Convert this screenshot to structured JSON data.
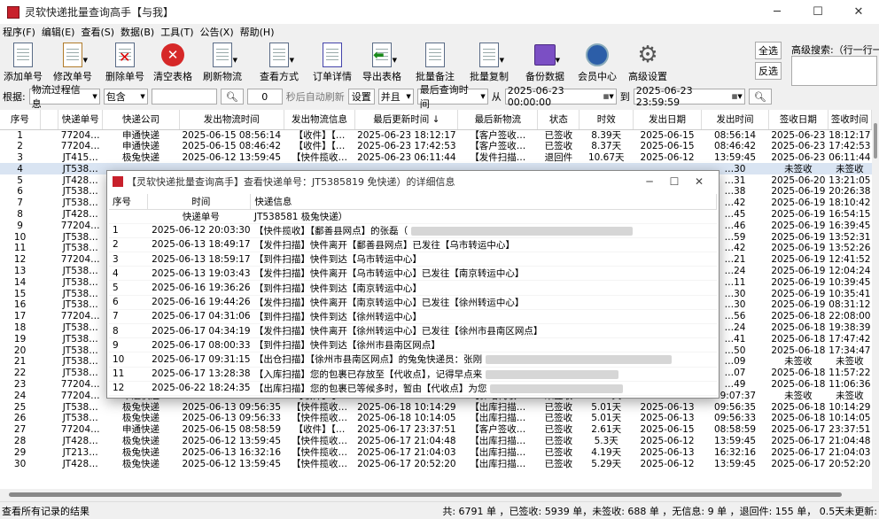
{
  "window": {
    "title": "灵软快递批量查询高手【与我】",
    "buttons": [
      "─",
      "☐",
      "✕"
    ]
  },
  "menu": [
    "程序(F)",
    "编辑(E)",
    "查看(S)",
    "数据(B)",
    "工具(T)",
    "公告(X)",
    "帮助(H)"
  ],
  "toolbar": [
    {
      "label": "添加单号",
      "icon": "add-doc-icon",
      "dd": false
    },
    {
      "label": "修改单号",
      "icon": "edit-doc-icon",
      "dd": true
    },
    {
      "label": "删除单号",
      "icon": "delete-doc-icon",
      "dd": false
    },
    {
      "label": "清空表格",
      "icon": "clear-table-icon",
      "dd": false
    },
    {
      "label": "刷新物流",
      "icon": "refresh-doc-icon",
      "dd": true
    },
    {
      "label": "查看方式",
      "icon": "view-mode-icon",
      "dd": true
    },
    {
      "label": "订单详情",
      "icon": "order-detail-icon",
      "dd": false
    },
    {
      "label": "导出表格",
      "icon": "export-table-icon",
      "dd": true
    },
    {
      "label": "批量备注",
      "icon": "batch-note-icon",
      "dd": false
    },
    {
      "label": "批量复制",
      "icon": "batch-copy-icon",
      "dd": true
    },
    {
      "label": "备份数据",
      "icon": "backup-icon",
      "dd": true
    },
    {
      "label": "会员中心",
      "icon": "member-center-icon",
      "dd": false
    },
    {
      "label": "高级设置",
      "icon": "gear-icon",
      "dd": false
    }
  ],
  "side_buttons": {
    "select_all": "全选",
    "invert": "反选"
  },
  "advanced_search": {
    "label": "高级搜索:（行一行一",
    "value": ""
  },
  "filter": {
    "by_label": "根据:",
    "by_value": "物流过程信息",
    "match_value": "包含",
    "keyword": "",
    "seconds": "0",
    "auto_refresh": "秒后自动刷新",
    "settings": "设置",
    "logic": "并且",
    "time_field": "最后查询时间",
    "from_label": "从",
    "from_value": "2025-06-23 00:00:00",
    "to_label": "到",
    "to_value": "2025-06-23 23:59:59"
  },
  "grid": {
    "columns": [
      "序号",
      "",
      "快递单号",
      "快递公司",
      "发出物流时间",
      "发出物流信息",
      "最后更新时间 ↓",
      "最后新物流",
      "状态",
      "时效",
      "发出日期",
      "发出时间",
      "签收日期",
      "签收时间"
    ],
    "rows": [
      [
        "1",
        "",
        "77204…",
        "申通快递",
        "2025-06-15  08:56:14",
        "【收件】【…",
        "2025-06-23  18:12:17",
        "【客户签收…",
        "已签收",
        "8.39天",
        "2025-06-15",
        "08:56:14",
        "2025-06-23",
        "18:12:17"
      ],
      [
        "2",
        "",
        "77204…",
        "申通快递",
        "2025-06-15  08:46:42",
        "【收件】【…",
        "2025-06-23  17:42:53",
        "【客户签收…",
        "已签收",
        "8.37天",
        "2025-06-15",
        "08:46:42",
        "2025-06-23",
        "17:42:53"
      ],
      [
        "3",
        "",
        "JT415…",
        "极兔快递",
        "2025-06-12  13:59:45",
        "【快件揽收…",
        "2025-06-23  06:11:44",
        "【发件扫描…",
        "退回件",
        "10.67天",
        "2025-06-12",
        "13:59:45",
        "2025-06-23",
        "06:11:44"
      ],
      [
        "4",
        "",
        "JT538…",
        "",
        "",
        "",
        "",
        "",
        "",
        "",
        "",
        "…30",
        "未签收",
        "未签收"
      ],
      [
        "5",
        "",
        "JT428…",
        "",
        "",
        "",
        "",
        "",
        "",
        "",
        "",
        "…31",
        "2025-06-20",
        "13:21:05"
      ],
      [
        "6",
        "",
        "JT538…",
        "",
        "",
        "",
        "",
        "",
        "",
        "",
        "",
        "…38",
        "2025-06-19",
        "20:26:38"
      ],
      [
        "7",
        "",
        "JT538…",
        "",
        "",
        "",
        "",
        "",
        "",
        "",
        "",
        "…42",
        "2025-06-19",
        "18:10:42"
      ],
      [
        "8",
        "",
        "JT428…",
        "",
        "",
        "",
        "",
        "",
        "",
        "",
        "",
        "…45",
        "2025-06-19",
        "16:54:15"
      ],
      [
        "9",
        "",
        "77204…",
        "",
        "",
        "",
        "",
        "",
        "",
        "",
        "",
        "…46",
        "2025-06-19",
        "16:39:45"
      ],
      [
        "10",
        "",
        "JT538…",
        "",
        "",
        "",
        "",
        "",
        "",
        "",
        "",
        "…59",
        "2025-06-19",
        "13:52:31"
      ],
      [
        "11",
        "",
        "JT538…",
        "",
        "",
        "",
        "",
        "",
        "",
        "",
        "",
        "…42",
        "2025-06-19",
        "13:52:26"
      ],
      [
        "12",
        "",
        "77204…",
        "",
        "",
        "",
        "",
        "",
        "",
        "",
        "",
        "…21",
        "2025-06-19",
        "12:41:52"
      ],
      [
        "13",
        "",
        "JT538…",
        "",
        "",
        "",
        "",
        "",
        "",
        "",
        "",
        "…24",
        "2025-06-19",
        "12:04:24"
      ],
      [
        "14",
        "",
        "JT538…",
        "",
        "",
        "",
        "",
        "",
        "",
        "",
        "",
        "…11",
        "2025-06-19",
        "10:39:45"
      ],
      [
        "15",
        "",
        "JT538…",
        "",
        "",
        "",
        "",
        "",
        "",
        "",
        "",
        "…30",
        "2025-06-19",
        "10:35:41"
      ],
      [
        "16",
        "",
        "JT538…",
        "",
        "",
        "",
        "",
        "",
        "",
        "",
        "",
        "…30",
        "2025-06-19",
        "08:31:12"
      ],
      [
        "17",
        "",
        "77204…",
        "",
        "",
        "",
        "",
        "",
        "",
        "",
        "",
        "…56",
        "2025-06-18",
        "22:08:00"
      ],
      [
        "18",
        "",
        "JT538…",
        "",
        "",
        "",
        "",
        "",
        "",
        "",
        "",
        "…24",
        "2025-06-18",
        "19:38:39"
      ],
      [
        "19",
        "",
        "JT538…",
        "",
        "",
        "",
        "",
        "",
        "",
        "",
        "",
        "…41",
        "2025-06-18",
        "17:47:42"
      ],
      [
        "20",
        "",
        "JT538…",
        "",
        "",
        "",
        "",
        "",
        "",
        "",
        "",
        "…50",
        "2025-06-18",
        "17:34:47"
      ],
      [
        "21",
        "",
        "JT538…",
        "",
        "",
        "",
        "",
        "",
        "",
        "",
        "",
        "…09",
        "未签收",
        "未签收"
      ],
      [
        "22",
        "",
        "JT538…",
        "",
        "",
        "",
        "",
        "",
        "",
        "",
        "",
        "…07",
        "2025-06-18",
        "11:57:22"
      ],
      [
        "23",
        "",
        "77204…",
        "",
        "",
        "",
        "",
        "",
        "",
        "",
        "",
        "…49",
        "2025-06-18",
        "11:06:36"
      ],
      [
        "24",
        "",
        "77204…",
        "申通快递",
        "2025-06-15  09:07:37",
        "【收件】【…",
        "2025-06-18  10:52:10",
        "【驿站代收…",
        "未签收",
        "3.07天",
        "2025-06-15",
        "09:07:37",
        "未签收",
        "未签收"
      ],
      [
        "25",
        "",
        "JT538…",
        "极兔快递",
        "2025-06-13  09:56:35",
        "【快件揽收…",
        "2025-06-18  10:14:29",
        "【出库扫描…",
        "已签收",
        "5.01天",
        "2025-06-13",
        "09:56:35",
        "2025-06-18",
        "10:14:29"
      ],
      [
        "26",
        "",
        "JT538…",
        "极兔快递",
        "2025-06-13  09:56:33",
        "【快件揽收…",
        "2025-06-18  10:14:05",
        "【出库扫描…",
        "已签收",
        "5.01天",
        "2025-06-13",
        "09:56:33",
        "2025-06-18",
        "10:14:05"
      ],
      [
        "27",
        "",
        "77204…",
        "申通快递",
        "2025-06-15  08:58:59",
        "【收件】【…",
        "2025-06-17  23:37:51",
        "【客户签收…",
        "已签收",
        "2.61天",
        "2025-06-15",
        "08:58:59",
        "2025-06-17",
        "23:37:51"
      ],
      [
        "28",
        "",
        "JT428…",
        "极兔快递",
        "2025-06-12  13:59:45",
        "【快件揽收…",
        "2025-06-17  21:04:48",
        "【出库扫描…",
        "已签收",
        "5.3天",
        "2025-06-12",
        "13:59:45",
        "2025-06-17",
        "21:04:48"
      ],
      [
        "29",
        "",
        "JT213…",
        "极兔快递",
        "2025-06-13  16:32:16",
        "【快件揽收…",
        "2025-06-17  21:04:03",
        "【出库扫描…",
        "已签收",
        "4.19天",
        "2025-06-13",
        "16:32:16",
        "2025-06-17",
        "21:04:03"
      ],
      [
        "30",
        "",
        "JT428…",
        "极兔快递",
        "2025-06-12  13:59:45",
        "【快件揽收…",
        "2025-06-17  20:52:20",
        "【出库扫描…",
        "已签收",
        "5.29天",
        "2025-06-12",
        "13:59:45",
        "2025-06-17",
        "20:52:20"
      ]
    ]
  },
  "dialog": {
    "title": "【灵软快递批量查询高手】查看快递单号：JT5385819        免快递）的详细信息",
    "buttons": [
      "─",
      "☐",
      "✕"
    ],
    "columns": [
      "序号",
      "时间",
      "快递信息"
    ],
    "header_row": {
      "label": "快递单号",
      "value": "JT538581        极兔快递）"
    },
    "rows": [
      [
        "1",
        "2025-06-12  20:03:30",
        "【快件揽收】【鄱善县网点】的张磊（"
      ],
      [
        "2",
        "2025-06-13  18:49:17",
        "【发件扫描】快件离开【鄱善县网点】已发往【乌市转运中心】"
      ],
      [
        "3",
        "2025-06-13  18:59:17",
        "【到件扫描】快件到达【乌市转运中心】"
      ],
      [
        "4",
        "2025-06-13  19:03:43",
        "【发件扫描】快件离开【乌市转运中心】已发往【南京转运中心】"
      ],
      [
        "5",
        "2025-06-16  19:36:26",
        "【到件扫描】快件到达【南京转运中心】"
      ],
      [
        "6",
        "2025-06-16  19:44:26",
        "【发件扫描】快件离开【南京转运中心】已发往【徐州转运中心】"
      ],
      [
        "7",
        "2025-06-17  04:31:06",
        "【到件扫描】快件到达【徐州转运中心】"
      ],
      [
        "8",
        "2025-06-17  04:34:19",
        "【发件扫描】快件离开【徐州转运中心】已发往【徐州市县南区网点】"
      ],
      [
        "9",
        "2025-06-17  08:00:33",
        "【到件扫描】快件到达【徐州市县南区网点】"
      ],
      [
        "10",
        "2025-06-17  09:31:15",
        "【出仓扫描】【徐州市县南区网点】的兔兔快递员：张刚"
      ],
      [
        "11",
        "2025-06-17  13:28:38",
        "【入库扫描】您的包裹已存放至【代收点】，记得早点来"
      ],
      [
        "12",
        "2025-06-22  18:24:35",
        "【出库扫描】您的包裹已等候多时，暂由【代收点】为您"
      ]
    ]
  },
  "status": {
    "left": "查看所有记录的结果",
    "right": "共: 6791 单 ，已签收: 5939 单，未签收: 688 单 ，无信息: 9 单 ，退回件: 155 单， 0.5天未更新:"
  },
  "colors": {
    "accent": "#d9e4f2",
    "app_icon": "#c8202b"
  }
}
